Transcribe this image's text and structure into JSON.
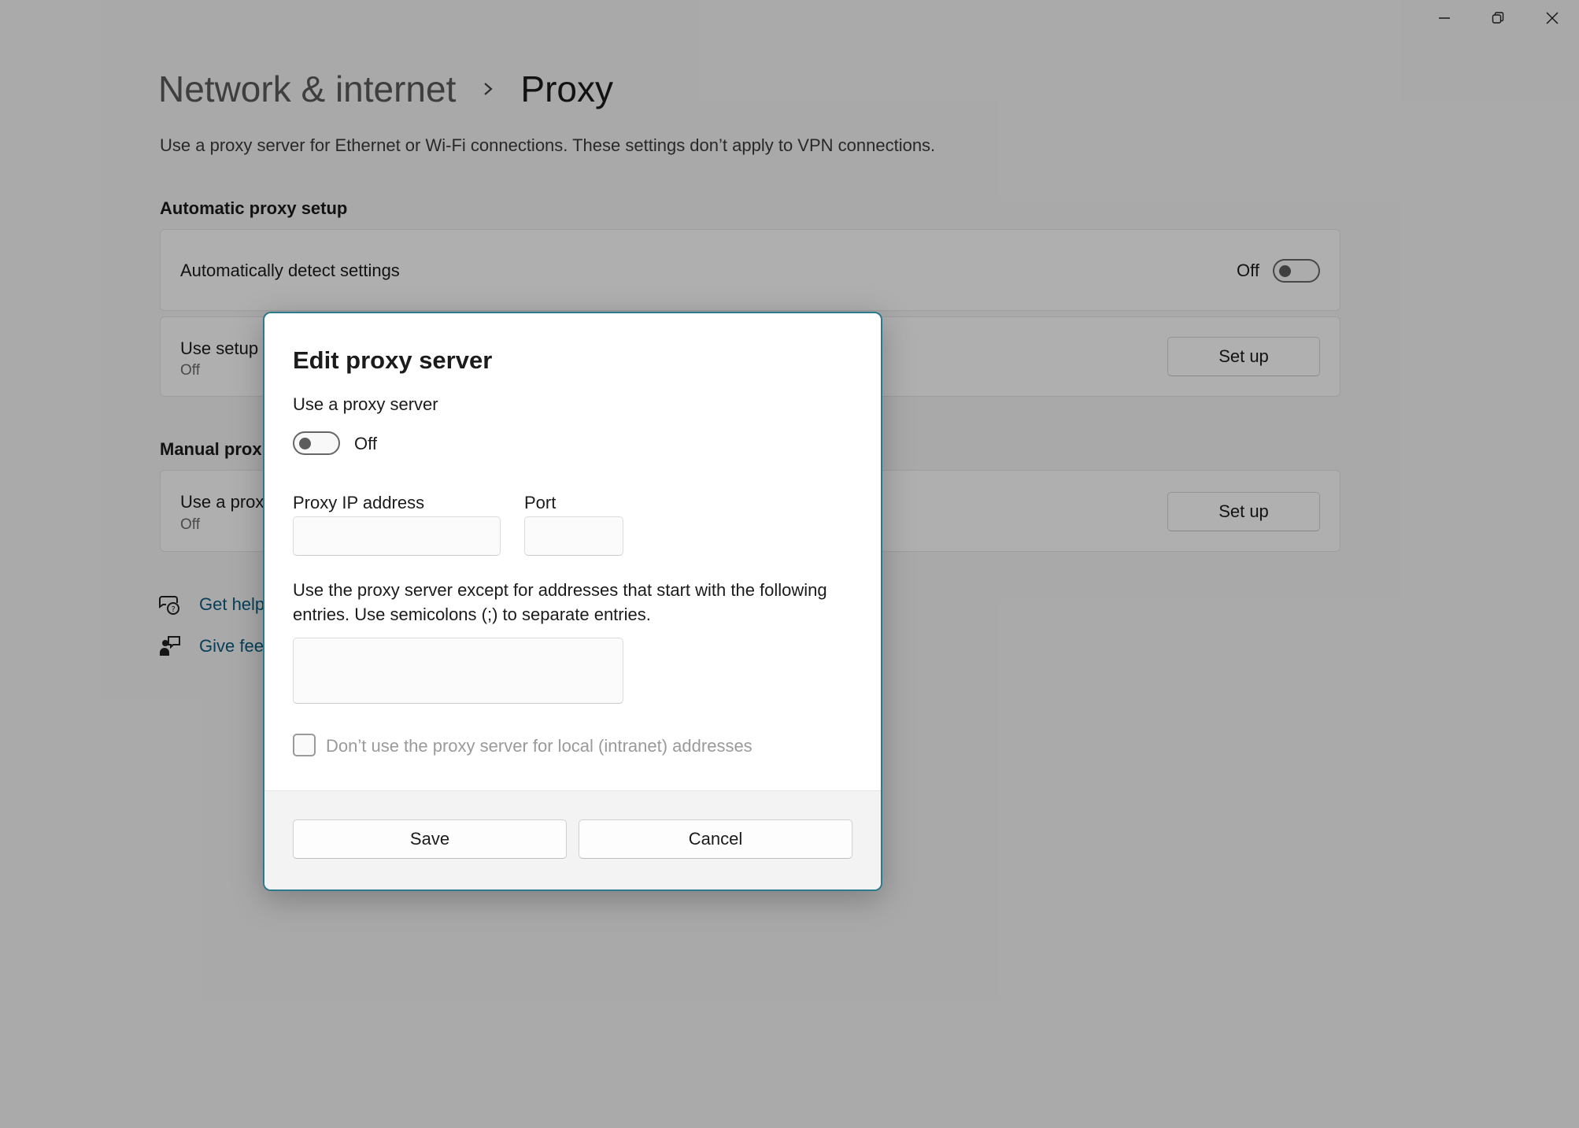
{
  "window": {
    "minimize_icon": "minimize-icon",
    "maximize_icon": "restore-icon",
    "close_icon": "close-icon"
  },
  "header": {
    "parent": "Network & internet",
    "separator_icon": "chevron-right-icon",
    "current": "Proxy"
  },
  "description": "Use a proxy server for Ethernet or Wi-Fi connections. These settings don’t apply to VPN connections.",
  "automatic": {
    "section_title": "Automatic proxy setup",
    "detect": {
      "label": "Automatically detect settings",
      "state": "Off"
    },
    "script": {
      "label": "Use setup",
      "state": "Off",
      "button": "Set up"
    }
  },
  "manual": {
    "section_title": "Manual prox",
    "proxy": {
      "label": "Use a prox",
      "state": "Off",
      "button": "Set up"
    }
  },
  "links": [
    {
      "label": "Get help",
      "icon": "help-chat-icon"
    },
    {
      "label": "Give fee",
      "icon": "feedback-icon"
    }
  ],
  "dialog": {
    "title": "Edit proxy server",
    "use_proxy_label": "Use a proxy server",
    "toggle_state": "Off",
    "ip_label": "Proxy IP address",
    "ip_value": "",
    "port_label": "Port",
    "port_value": "",
    "exceptions_desc": "Use the proxy server except for addresses that start with the following entries. Use semicolons (;) to separate entries.",
    "exceptions_value": "",
    "local_checkbox_label": "Don’t use the proxy server for local (intranet) addresses",
    "local_checkbox_checked": false,
    "save": "Save",
    "cancel": "Cancel"
  },
  "colors": {
    "dialog_border": "#2c7a8c",
    "link": "#0a5a80",
    "overlay": "rgba(0,0,0,0.30)"
  }
}
